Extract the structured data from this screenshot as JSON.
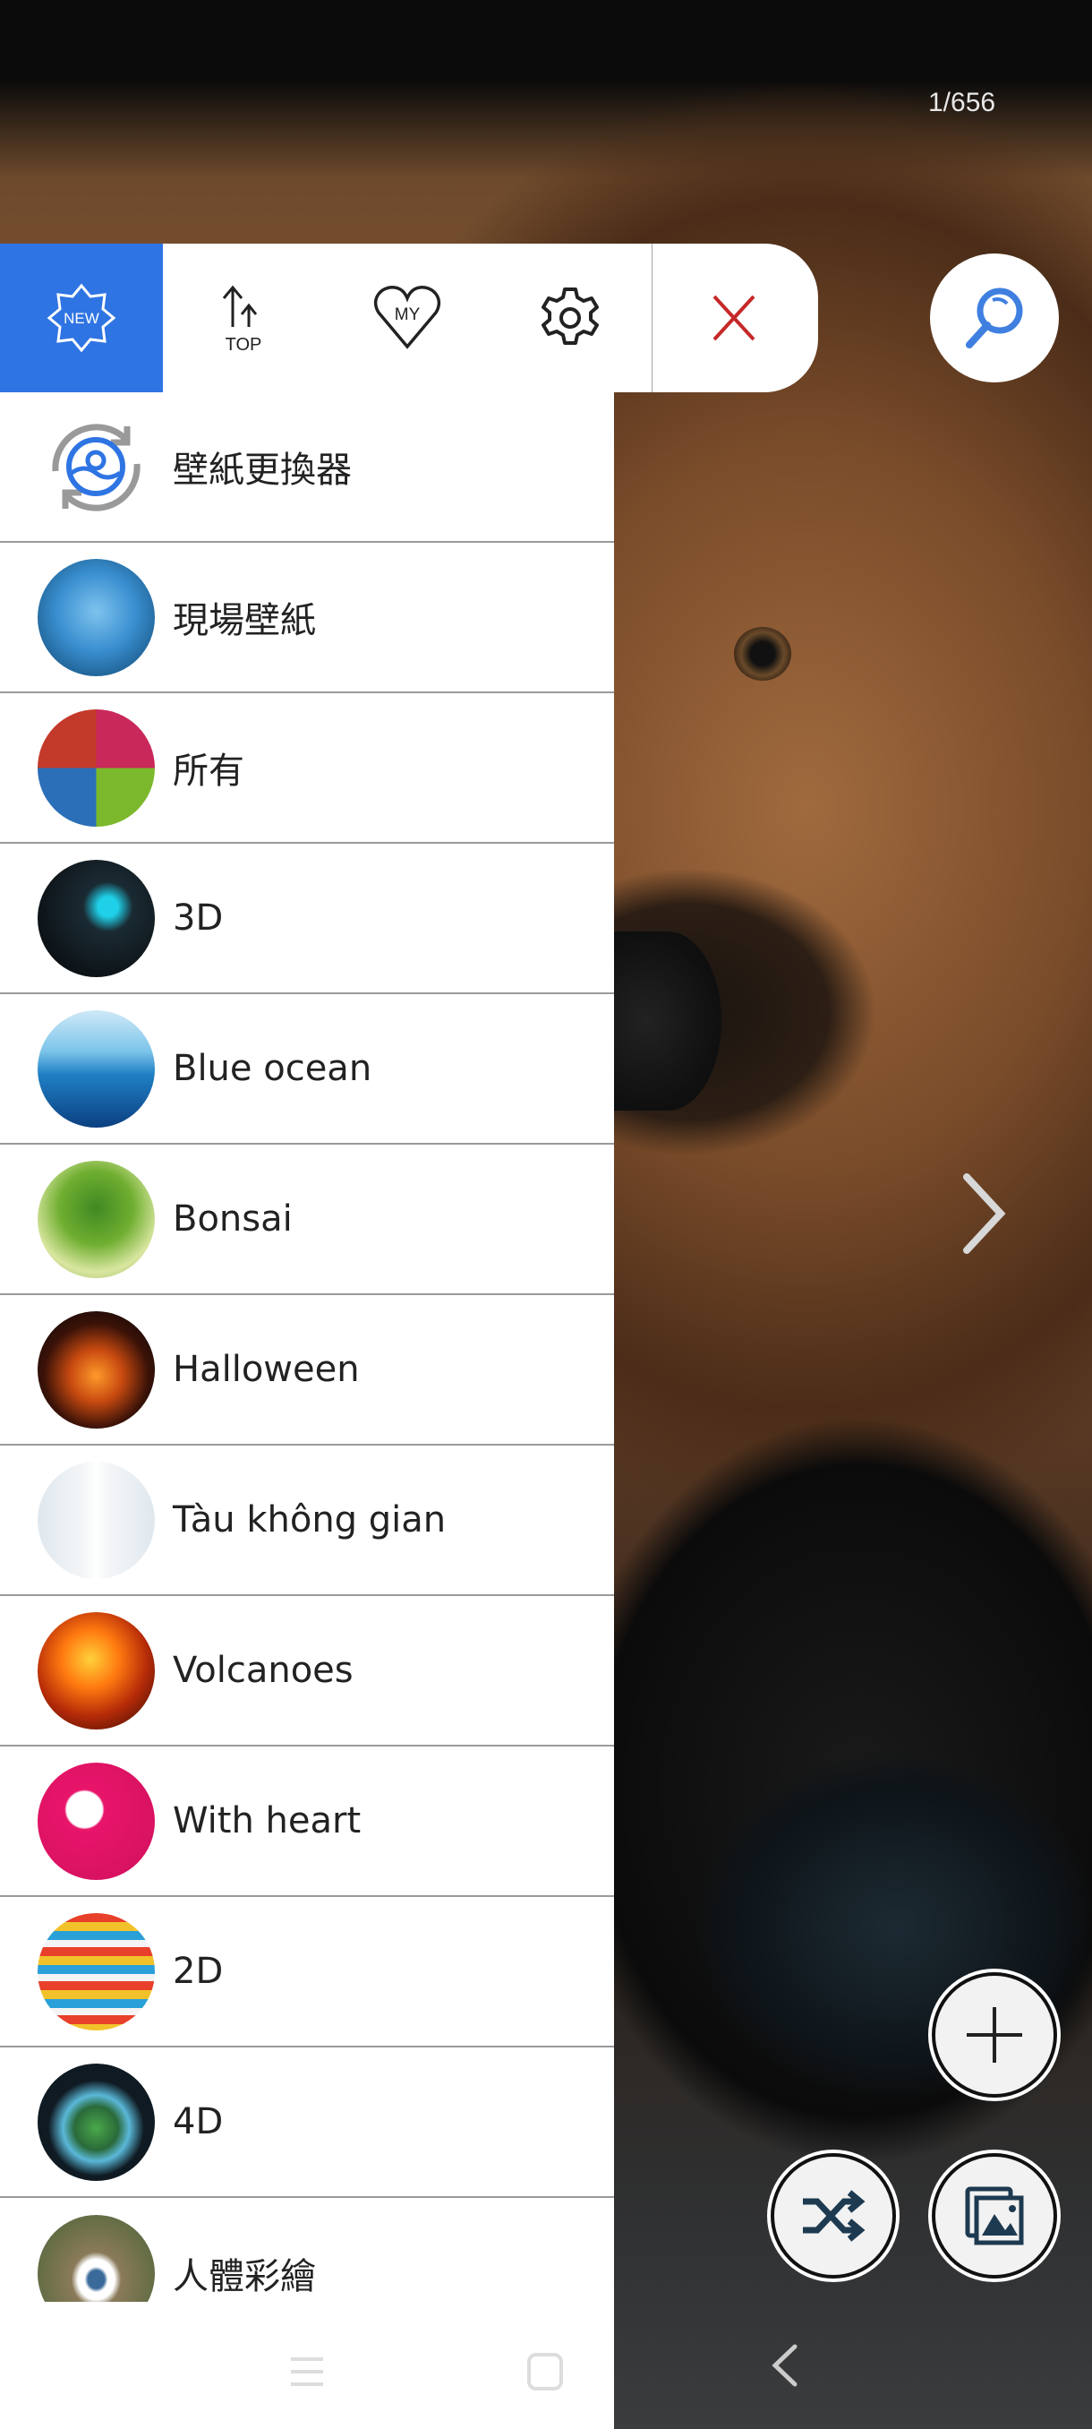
{
  "counter": "1/656",
  "toolbar": {
    "new_label": "NEW",
    "top_label": "TOP",
    "my_label": "MY",
    "accent": "#2f74e3",
    "close_color": "#c62828"
  },
  "drawer": {
    "items": [
      {
        "label": "壁紙更換器",
        "icon": "wallpaper-changer-icon"
      },
      {
        "label": "現場壁紙",
        "icon": "blue-bird-thumbnail"
      },
      {
        "label": "所有",
        "icon": "all-collage-thumbnail"
      },
      {
        "label": "3D",
        "icon": "3d-thumbnail"
      },
      {
        "label": "Blue ocean",
        "icon": "ocean-thumbnail"
      },
      {
        "label": "Bonsai",
        "icon": "bonsai-thumbnail"
      },
      {
        "label": "Halloween",
        "icon": "pumpkin-thumbnail"
      },
      {
        "label": "Tàu không gian",
        "icon": "space-shuttle-thumbnail"
      },
      {
        "label": "Volcanoes",
        "icon": "volcano-thumbnail"
      },
      {
        "label": "With heart",
        "icon": "love-heart-thumbnail"
      },
      {
        "label": "2D",
        "icon": "striped-apple-thumbnail"
      },
      {
        "label": "4D",
        "icon": "island-hand-thumbnail"
      },
      {
        "label": "人體彩繪",
        "icon": "painted-eye-thumbnail"
      }
    ]
  }
}
